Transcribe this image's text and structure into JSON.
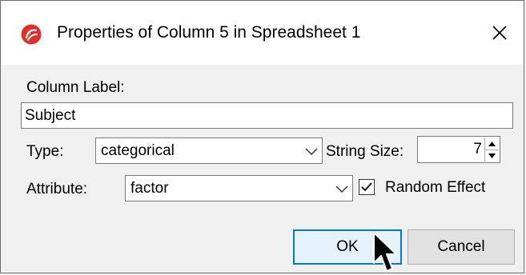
{
  "window": {
    "title": "Properties of Column 5 in Spreadsheet 1",
    "icon": "app-logo-icon",
    "accent": "#0078d7"
  },
  "column_label": {
    "label": "Column Label:",
    "value": "Subject"
  },
  "type": {
    "label": "Type:",
    "value": "categorical"
  },
  "string_size": {
    "label": "String Size:",
    "value": "7"
  },
  "attribute": {
    "label": "Attribute:",
    "value": "factor"
  },
  "random_effect": {
    "label": "Random Effect",
    "checked": true
  },
  "buttons": {
    "ok": "OK",
    "cancel": "Cancel"
  }
}
